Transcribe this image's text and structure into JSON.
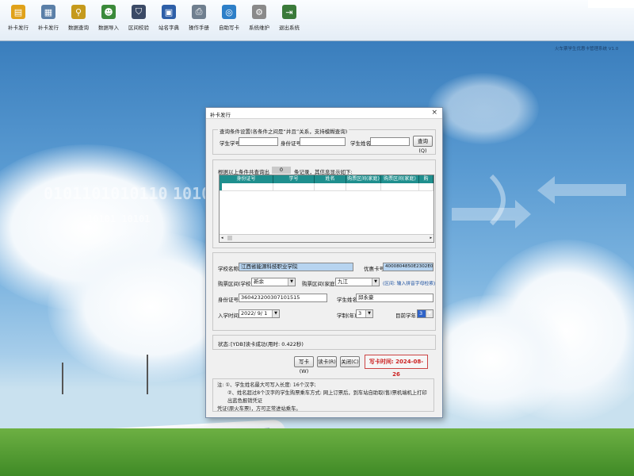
{
  "toolbar": {
    "items": [
      {
        "label": "补卡发行",
        "icon": "new-card-icon",
        "color": "#e0a21a"
      },
      {
        "label": "补卡发行",
        "icon": "document-icon",
        "color": "#5a7fa8"
      },
      {
        "label": "数据查询",
        "icon": "search-icon",
        "color": "#c59a1c"
      },
      {
        "label": "数据导入",
        "icon": "users-import-icon",
        "color": "#3a8a3a"
      },
      {
        "label": "区间校验",
        "icon": "shield-icon",
        "color": "#3b4a66"
      },
      {
        "label": "站名字典",
        "icon": "book-icon",
        "color": "#2d5fa8"
      },
      {
        "label": "操作手册",
        "icon": "printer-icon",
        "color": "#6f7f8f"
      },
      {
        "label": "自助写卡",
        "icon": "globe-icon",
        "color": "#2d7fc8"
      },
      {
        "label": "系统维护",
        "icon": "gear-icon",
        "color": "#8a8a8a"
      },
      {
        "label": "退出系统",
        "icon": "exit-icon",
        "color": "#3a7a3a"
      }
    ]
  },
  "slogan": "火车票学生优惠卡管理系统 V1.0",
  "background": {
    "binary_1": "0101101010110",
    "binary_2": "1010",
    "binary_3": "10101 10101"
  },
  "dialog": {
    "title": "补卡发行",
    "close": "×",
    "query_group_title": "查询条件设置(各条件之间是“并且”关系，支持模糊查询)",
    "student_no_label": "学生学号",
    "id_no_label": "身份证号",
    "name_label": "学生姓名",
    "query_button": "查询(Q)",
    "result_text_1": "根据以上条件共查询出",
    "result_count": "0",
    "result_text_2": "条记录，其信息显示如下:",
    "grid_columns": [
      "身份证号",
      "学号",
      "姓名",
      "购票区间(家庭)",
      "购票区间(家庭)",
      "购"
    ],
    "school_label": "学校名称",
    "school_value": "江西省能源科技职业学院",
    "card_no_label": "优惠卡号",
    "card_no_value": "4000804850E2302E0",
    "from_label": "购票区间(学校)",
    "from_value": "新余",
    "to_label": "购票区间(家庭)",
    "to_value": "九江",
    "to_hint": "(区间: 输入拼音字母检索)",
    "id_label": "身份证号",
    "id_value": "360423200307101515",
    "stu_name_label": "学生姓名",
    "stu_name_value": "邱永豪",
    "enroll_label": "入学时间",
    "enroll_value": "2022/ 9/ 1",
    "years_label": "学制(年)",
    "years_value": "3",
    "grade_label": "目前学年",
    "grade_value": "3",
    "status_label": "状态:",
    "status_value": "[YDB]读卡成功(用时: 0.422秒)",
    "write_button": "写卡(W)",
    "read_button": "读卡(R)",
    "close_button": "关闭(C)",
    "write_time_label": "写卡时间:",
    "write_time_value": "2024-08-26",
    "note_1": "注: ①、学生姓名最大可写入长度: 16个汉字;",
    "note_2": "②、姓名超过8个汉字的学生购票乘车方式: 网上订票后，到车站自助取(售)票机端机上打印出蓝色报销凭证",
    "note_3": "凭证(原火车票)，方可正常进站乘车。"
  }
}
